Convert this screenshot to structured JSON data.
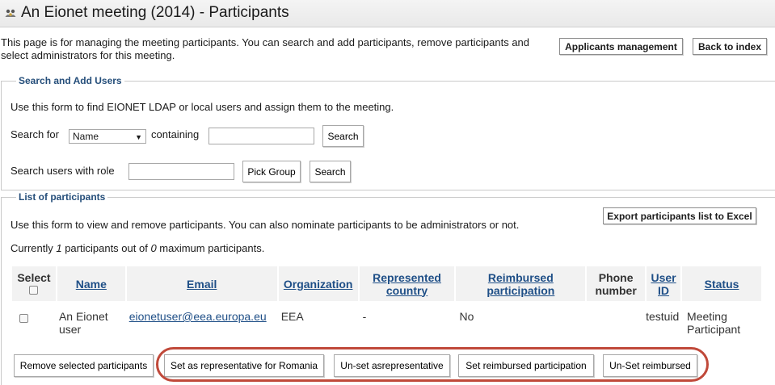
{
  "header": {
    "title": "An Eionet meeting (2014) - Participants",
    "icon": "people-icon"
  },
  "intro": "This page is for managing the meeting participants. You can search and add participants, remove participants and select administrators for this meeting.",
  "top_buttons": {
    "applicants": "Applicants management",
    "back": "Back to index"
  },
  "search_section": {
    "legend": "Search and Add Users",
    "description": "Use this form to find EIONET LDAP or local users and assign them to the meeting.",
    "search_for_label": "Search for",
    "search_field_value": "Name",
    "containing_label": "containing",
    "containing_value": "",
    "search_button": "Search",
    "role_label": "Search users with role",
    "role_value": "",
    "pick_group_button": "Pick Group",
    "role_search_button": "Search"
  },
  "participants_section": {
    "legend": "List of participants",
    "description": "Use this form to view and remove participants. You can also nominate participants to be administrators or not.",
    "export_button": "Export participants list to Excel",
    "count_prefix": "Currently ",
    "count_current": "1",
    "count_middle": " participants out of ",
    "count_max": "0",
    "count_suffix": " maximum participants.",
    "columns": {
      "select": "Select",
      "name": "Name",
      "email": "Email",
      "organization": "Organization",
      "represented_1": "Represented",
      "represented_2": "country",
      "reimbursed_1": "Reimbursed",
      "reimbursed_2": "participation",
      "phone_1": "Phone",
      "phone_2": "number",
      "userid_1": "User",
      "userid_2": "ID",
      "status": "Status"
    },
    "rows": [
      {
        "name_1": "An Eionet",
        "name_2": "user",
        "email": "eionetuser@eea.europa.eu",
        "organization": "EEA",
        "represented_country": "-",
        "reimbursed": "No",
        "phone": "",
        "user_id": "testuid",
        "status_1": "Meeting",
        "status_2": "Participant"
      }
    ]
  },
  "actions": {
    "remove": "Remove selected participants",
    "set_representative": "Set as representative for Romania",
    "unset_representative": "Un-set asrepresentative",
    "set_reimbursed": "Set reimbursed participation",
    "unset_reimbursed": "Un-Set reimbursed"
  },
  "colors": {
    "link": "#1f4f87",
    "legend": "#254e7a",
    "highlight": "#c0493a"
  }
}
